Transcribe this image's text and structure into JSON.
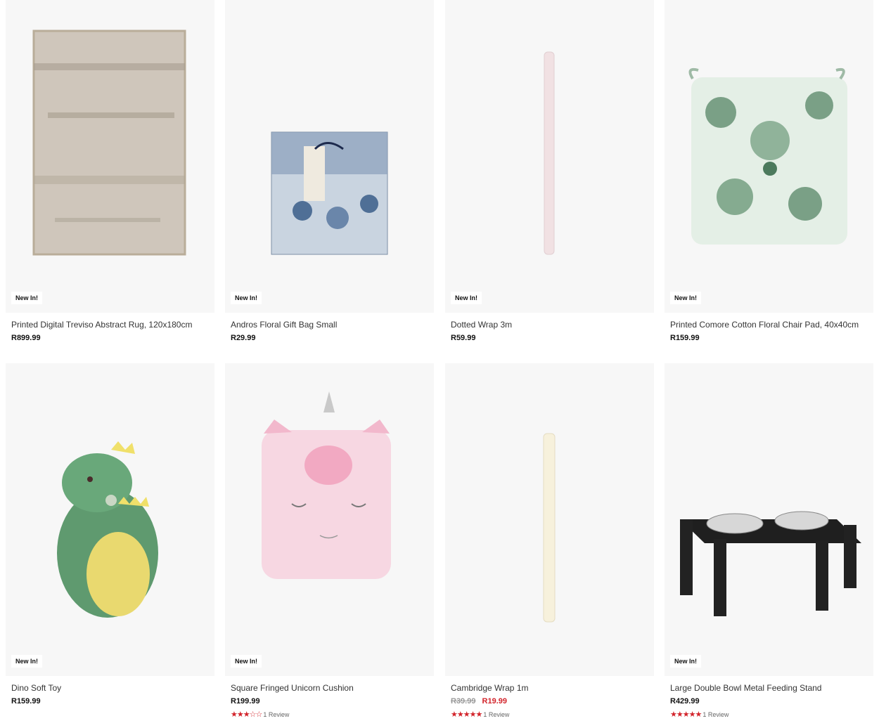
{
  "products": [
    {
      "title": "Printed Digital Treviso Abstract Rug, 120x180cm",
      "badge": "New In!",
      "price": "R899.99",
      "image": "rug-image"
    },
    {
      "title": "Andros Floral Gift Bag Small",
      "badge": "New In!",
      "price": "R29.99",
      "image": "gift-bag-image"
    },
    {
      "title": "Dotted Wrap 3m",
      "badge": "New In!",
      "price": "R59.99",
      "image": "wrap-roll-image"
    },
    {
      "title": "Printed Comore Cotton Floral Chair Pad, 40x40cm",
      "badge": "New In!",
      "price": "R159.99",
      "image": "chair-pad-image"
    },
    {
      "title": "Dino Soft Toy",
      "badge": "New In!",
      "price": "R159.99",
      "image": "dino-toy-image"
    },
    {
      "title": "Square Fringed Unicorn Cushion",
      "badge": "New In!",
      "price": "R199.99",
      "stars": "★★★☆☆",
      "rating": 3,
      "reviews": "1 Review",
      "image": "unicorn-cushion-image"
    },
    {
      "title": "Cambridge Wrap 1m",
      "old_price": "R39.99",
      "price": "R19.99",
      "stars": "★★★★★",
      "rating": 5,
      "reviews": "1 Review",
      "image": "wrap-roll-image"
    },
    {
      "title": "Large Double Bowl Metal Feeding Stand",
      "badge": "New In!",
      "price": "R429.99",
      "stars": "★★★★★",
      "rating": 5,
      "reviews": "1 Review",
      "image": "feeding-stand-image"
    }
  ]
}
